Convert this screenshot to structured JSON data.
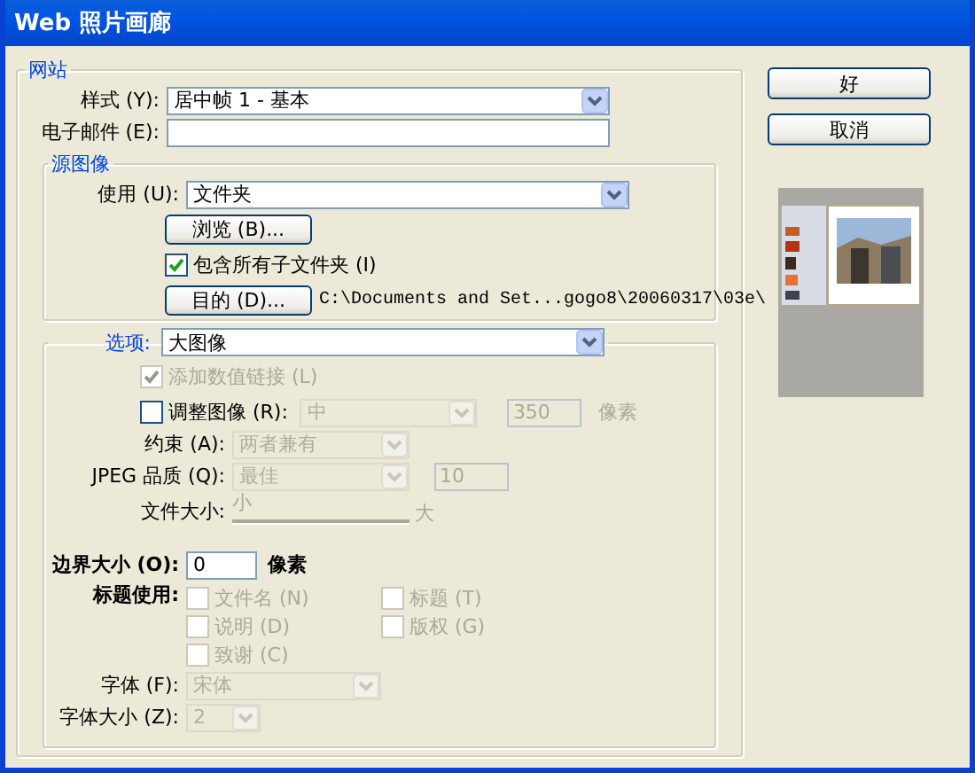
{
  "window": {
    "title": "Web 照片画廊"
  },
  "site": {
    "legend": "网站",
    "style": {
      "label": "样式 (Y):",
      "value": "居中帧 1 - 基本"
    },
    "email": {
      "label": "电子邮件 (E):"
    }
  },
  "source": {
    "legend": "源图像",
    "use": {
      "label": "使用 (U):",
      "value": "文件夹"
    },
    "browse_button": "浏览 (B)...",
    "include_subfolders": {
      "label": "包含所有子文件夹 (I)",
      "checked": true
    },
    "destination_button": "目的 (D)...",
    "destination_path": "C:\\Documents and Set...gogo8\\20060317\\03e\\"
  },
  "options": {
    "label": "选项:",
    "value": "大图像",
    "add_numeric_links": {
      "label": "添加数值链接 (L)",
      "checked": true,
      "disabled": true
    },
    "resize": {
      "label": "调整图像 (R):",
      "checked": false,
      "value": "中",
      "pixels": "350",
      "unit": "像素",
      "disabled": true
    },
    "constrain": {
      "label": "约束 (A):",
      "value": "两者兼有",
      "disabled": true
    },
    "jpeg_quality": {
      "label": "JPEG 品质 (Q):",
      "value": "最佳",
      "number": "10",
      "disabled": true
    },
    "file_size": {
      "label": "文件大小:",
      "min_label": "小",
      "max_label": "大",
      "disabled": true
    },
    "border_size": {
      "label": "边界大小 (O):",
      "value": "0",
      "unit": "像素"
    },
    "titles_use": {
      "label": "标题使用:",
      "items": [
        {
          "label": "文件名 (N)",
          "checked": false,
          "disabled": true
        },
        {
          "label": "标题 (T)",
          "checked": false,
          "disabled": true
        },
        {
          "label": "说明 (D)",
          "checked": false,
          "disabled": true
        },
        {
          "label": "版权 (G)",
          "checked": false,
          "disabled": true
        },
        {
          "label": "致谢 (C)",
          "checked": false,
          "disabled": true
        }
      ]
    },
    "font": {
      "label": "字体 (F):",
      "value": "宋体",
      "disabled": true
    },
    "font_size": {
      "label": "字体大小 (Z):",
      "value": "2",
      "disabled": true
    }
  },
  "buttons": [
    "好",
    "取消"
  ]
}
